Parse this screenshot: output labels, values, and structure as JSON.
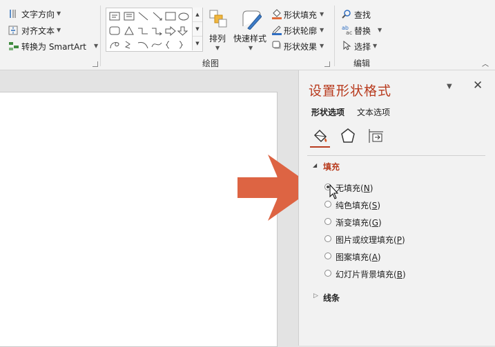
{
  "ribbon": {
    "text_group": {
      "text_direction": "文字方向",
      "align_text": "对齐文本",
      "convert_smartart": "转换为 SmartArt"
    },
    "drawing_group": {
      "label": "绘图",
      "arrange": "排列",
      "quick_styles": "快速样式",
      "shape_fill": "形状填充",
      "shape_outline": "形状轮廓",
      "shape_effects": "形状效果"
    },
    "editing_group": {
      "label": "编辑",
      "find": "查找",
      "replace": "替换",
      "select": "选择"
    },
    "colors": {
      "accent": "#b83b1e",
      "arrow": "#dd6443"
    }
  },
  "pane": {
    "title": "设置形状格式",
    "tabs": [
      "形状选项",
      "文本选项"
    ],
    "fill_section": "填充",
    "fill_options": [
      {
        "text": "无填充",
        "key": "N",
        "selected": true
      },
      {
        "text": "纯色填充",
        "key": "S",
        "selected": false
      },
      {
        "text": "渐变填充",
        "key": "G",
        "selected": false
      },
      {
        "text": "图片或纹理填充",
        "key": "P",
        "selected": false
      },
      {
        "text": "图案填充",
        "key": "A",
        "selected": false
      },
      {
        "text": "幻灯片背景填充",
        "key": "B",
        "selected": false
      }
    ],
    "line_section": "线条"
  }
}
